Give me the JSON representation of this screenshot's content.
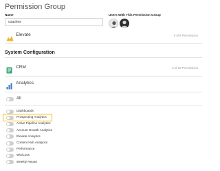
{
  "header": {
    "title": "Permission Group"
  },
  "form": {
    "name_label": "Name",
    "name_value": "coaches",
    "users_label": "Users With This Permission Group"
  },
  "modules": {
    "elevate": {
      "label": "Elevate",
      "count": "8 of 6 Permissions",
      "icon": "elevate-icon"
    }
  },
  "system_configuration": {
    "heading": "System Configuration",
    "crm": {
      "label": "CRM",
      "count": "6 of 20 Permissions",
      "icon": "crm-icon"
    },
    "analytics": {
      "label": "Analytics",
      "icon": "analytics-icon"
    },
    "all_label": "All",
    "permissions": [
      {
        "label": "Dashboards",
        "on": false,
        "highlighted": false
      },
      {
        "label": "Prospecting Analytics",
        "on": false,
        "highlighted": true
      },
      {
        "label": "Active Pipeline Analytics",
        "on": false,
        "highlighted": false
      },
      {
        "label": "Account Growth Analytics",
        "on": false,
        "highlighted": false
      },
      {
        "label": "Elevate Analytics",
        "on": false,
        "highlighted": false
      },
      {
        "label": "Content Hub Analytics",
        "on": false,
        "highlighted": false
      },
      {
        "label": "Performance",
        "on": false,
        "highlighted": false
      },
      {
        "label": "Win/Loss",
        "on": false,
        "highlighted": false
      },
      {
        "label": "Weekly Report",
        "on": false,
        "highlighted": false
      }
    ]
  },
  "colors": {
    "highlight": "#f2c200",
    "elevate_icon": "#f0b323",
    "crm_icon": "#3aa675",
    "analytics_icon": "#3a78c9",
    "toggle_off": "#cfcfcf"
  }
}
